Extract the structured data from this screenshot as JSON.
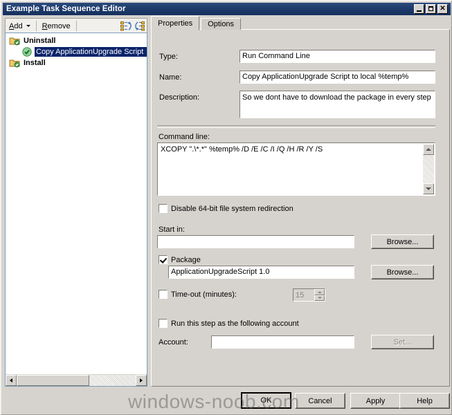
{
  "window": {
    "title": "Example Task Sequence Editor",
    "minimize_label": "Minimize",
    "maximize_label": "Maximize",
    "close_label": "✕"
  },
  "toolbar": {
    "add_label": "Add",
    "add_accel": "A",
    "remove_label": "Remove",
    "remove_accel": "R",
    "icon_move_up": "move-step-icon",
    "icon_move_down": "reorder-step-icon"
  },
  "tree": {
    "items": [
      {
        "label": "Uninstall",
        "level": 1,
        "icon": "folder-group-icon",
        "selected": false
      },
      {
        "label": "Copy ApplicationUpgrade Script",
        "level": 2,
        "icon": "green-check-step-icon",
        "selected": true
      },
      {
        "label": "Install",
        "level": 1,
        "icon": "folder-group-icon",
        "selected": false
      }
    ]
  },
  "tabs": [
    {
      "label": "Properties",
      "active": true
    },
    {
      "label": "Options",
      "active": false
    }
  ],
  "form": {
    "type_label": "Type:",
    "type_value": "Run Command Line",
    "name_label": "Name:",
    "name_value": "Copy ApplicationUpgrade Script to local %temp%",
    "description_label": "Description:",
    "description_value": "So we dont have to download the package in every step",
    "command_line_label": "Command line:",
    "command_line_value": "XCOPY \".\\*.*\" %temp% /D /E /C /I /Q /H /R /Y /S",
    "disable_redirection_label": "Disable 64-bit file system redirection",
    "disable_redirection_checked": false,
    "start_in_label": "Start in:",
    "start_in_value": "",
    "start_in_browse_label": "Browse...",
    "package_label": "Package",
    "package_checked": true,
    "package_value": "ApplicationUpgradeScript 1.0",
    "package_browse_label": "Browse...",
    "timeout_label": "Time-out (minutes):",
    "timeout_checked": false,
    "timeout_value": "15",
    "run_as_label": "Run this step as the following account",
    "run_as_checked": false,
    "account_label": "Account:",
    "account_value": "",
    "account_set_label": "Set..."
  },
  "footer": {
    "ok_label": "OK",
    "cancel_label": "Cancel",
    "apply_label": "Apply",
    "help_label": "Help"
  },
  "watermark": {
    "text": "windows-noob.com"
  },
  "colors": {
    "titlebar": "#1d3a6a",
    "face": "#d6d3ce",
    "selection": "#0a246a",
    "field": "#ffffff"
  }
}
